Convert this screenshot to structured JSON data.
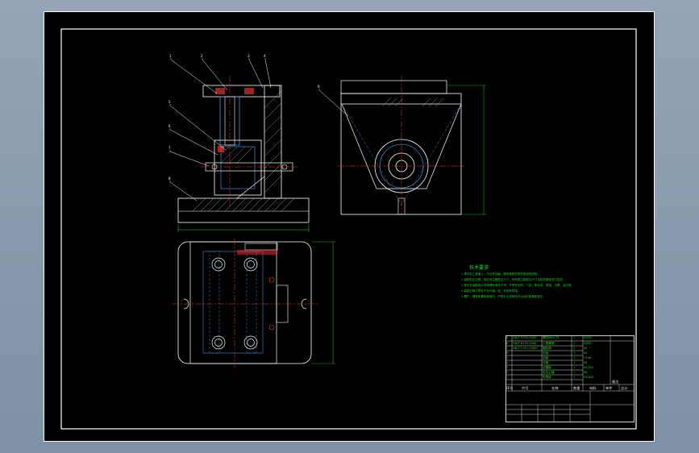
{
  "window": {
    "background_color": "#8fa0b3"
  },
  "drawing": {
    "line_color": "#ffffff",
    "centerline_color": "#ff3030",
    "dimension_color": "#20e020",
    "hidden_line_color": "#3fb0ff",
    "part_leaders": [
      "1",
      "2",
      "3",
      "4",
      "5",
      "6",
      "7",
      "8",
      "9"
    ]
  },
  "tech_requirements": {
    "title": "技术要求",
    "lines": [
      "1.零件加工表面上，不应有划痕、擦伤等损伤零件表面的缺陷。",
      "2.装配前应对零、部件的主要配合尺寸，特别是过盈配合尺寸及相关精度进行复查。",
      "3.零件在装配前必须清理和清洗干净，不得有毛刺、飞边、氧化皮、锈蚀、切屑、油污等。",
      "4.装配过程中零件不允许磕、碰、划伤和锈蚀。",
      "5.螺钉、螺栓和螺母紧固时，严禁打击或使用不合适的旋具和扳手。"
    ]
  },
  "title_block": {
    "header": [
      "序号",
      "代号",
      "名称",
      "数量",
      "材料",
      "单件",
      "总计",
      "备注"
    ],
    "rows": [
      [
        "9",
        "GB/T 5783-2000",
        "螺栓M8×25",
        "1",
        "Q235"
      ],
      [
        "8",
        "GB/T 6170-2000",
        "六角螺母",
        "1",
        "Q235"
      ],
      [
        "7",
        "GB/T 119.1-2000",
        "圆柱销",
        "2",
        "45"
      ],
      [
        "6",
        "",
        "压板",
        "1",
        "45"
      ],
      [
        "5",
        "",
        "钻套",
        "1",
        "T10A"
      ],
      [
        "4",
        "",
        "衬套",
        "1",
        "45"
      ],
      [
        "3",
        "",
        "钻模板",
        "1",
        "HT200"
      ],
      [
        "2",
        "",
        "定位心轴",
        "1",
        "45"
      ],
      [
        "1",
        "",
        "夹具体",
        "1",
        "HT200"
      ]
    ]
  }
}
